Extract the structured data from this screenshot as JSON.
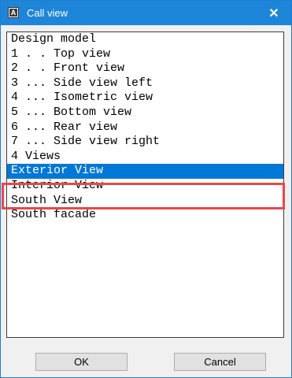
{
  "window": {
    "title": "Call view",
    "close_glyph": "✕"
  },
  "list": {
    "items": [
      "Design model",
      "1 . . Top view",
      "2 . . Front view",
      "3 ... Side view left",
      "4 ... Isometric view",
      "5 ... Bottom view",
      "6 ... Rear view",
      "7 ... Side view right",
      "4 Views",
      "Exterior View",
      "Interior View",
      "South View",
      "South facade"
    ],
    "selected": "Exterior View"
  },
  "buttons": {
    "ok": "OK",
    "cancel": "Cancel"
  },
  "colors": {
    "titlebar": "#1e86d8",
    "selection": "#0078d7",
    "highlight_outline": "#e8474c"
  }
}
